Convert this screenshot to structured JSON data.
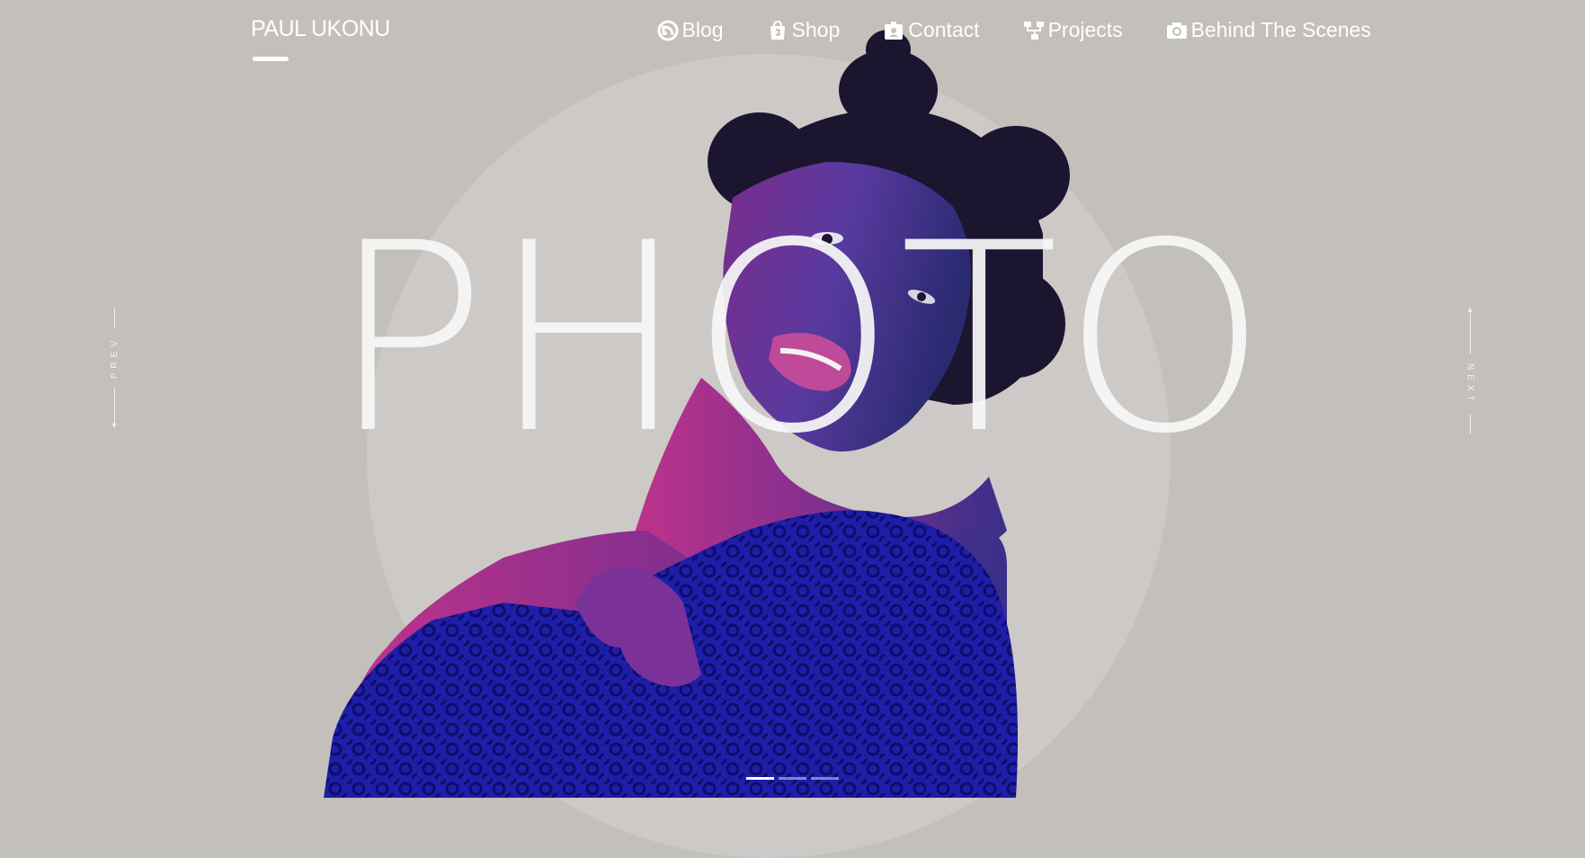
{
  "brand": {
    "name": "PAUL UKONU"
  },
  "nav": {
    "items": [
      {
        "label": "Blog",
        "icon": "blog-feed-icon"
      },
      {
        "label": "Shop",
        "icon": "shopping-bag-icon"
      },
      {
        "label": "Contact",
        "icon": "contact-card-icon"
      },
      {
        "label": "Projects",
        "icon": "sitemap-icon"
      },
      {
        "label": "Behind The Scenes",
        "icon": "camera-icon"
      }
    ]
  },
  "hero": {
    "word": "PHOTO"
  },
  "controls": {
    "prev_label": "PREV",
    "next_label": "NEXT"
  },
  "pagination": {
    "slides": 3,
    "active": 1
  },
  "colors": {
    "background": "#c3bfbb",
    "halo": "#cdc9c6",
    "text": "#ffffff",
    "sweater": "#1f1fa0",
    "skin_magenta": "#b23a88"
  }
}
